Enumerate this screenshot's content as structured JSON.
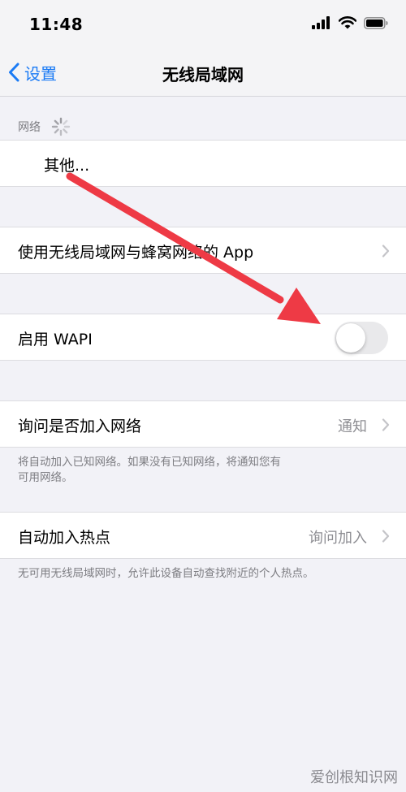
{
  "status_bar": {
    "time": "11:48"
  },
  "nav": {
    "back_label": "设置",
    "title": "无线局域网"
  },
  "networks": {
    "header": "网络",
    "other_label": "其他..."
  },
  "apps_row": {
    "label": "使用无线局域网与蜂窝网络的 App"
  },
  "wapi_row": {
    "label": "启用 WAPI",
    "enabled": false
  },
  "ask_join": {
    "label": "询问是否加入网络",
    "value": "通知",
    "footer_line1": "将自动加入已知网络。如果没有已知网络，将通知您有",
    "footer_line2": "可用网络。"
  },
  "hotspot": {
    "label": "自动加入热点",
    "value": "询问加入",
    "footer": "无可用无线局域网时，允许此设备自动查找附近的个人热点。"
  },
  "watermark": "爱创根知识网",
  "colors": {
    "accent": "#1b7bf5",
    "arrow": "#ee3a45",
    "background": "#f2f2f7"
  }
}
